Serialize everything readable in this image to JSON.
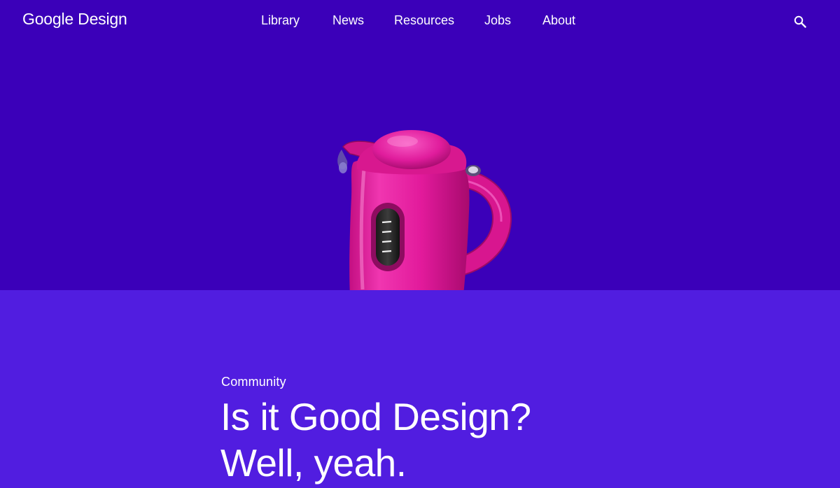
{
  "site": {
    "logo_text": "Google Design"
  },
  "nav": {
    "items": [
      {
        "label": "Library"
      },
      {
        "label": "News"
      },
      {
        "label": "Resources"
      },
      {
        "label": "Jobs"
      },
      {
        "label": "About"
      }
    ],
    "search_icon": "search-icon"
  },
  "hero": {
    "image": "pink-electric-kettle-illustration"
  },
  "article": {
    "category": "Community",
    "title_line_1": "Is it Good Design?",
    "title_line_2": "Well, yeah."
  },
  "colors": {
    "header_background": "#3b00b9",
    "panel_background": "#511de0",
    "kettle": "#e3189a",
    "text": "#ffffff"
  }
}
